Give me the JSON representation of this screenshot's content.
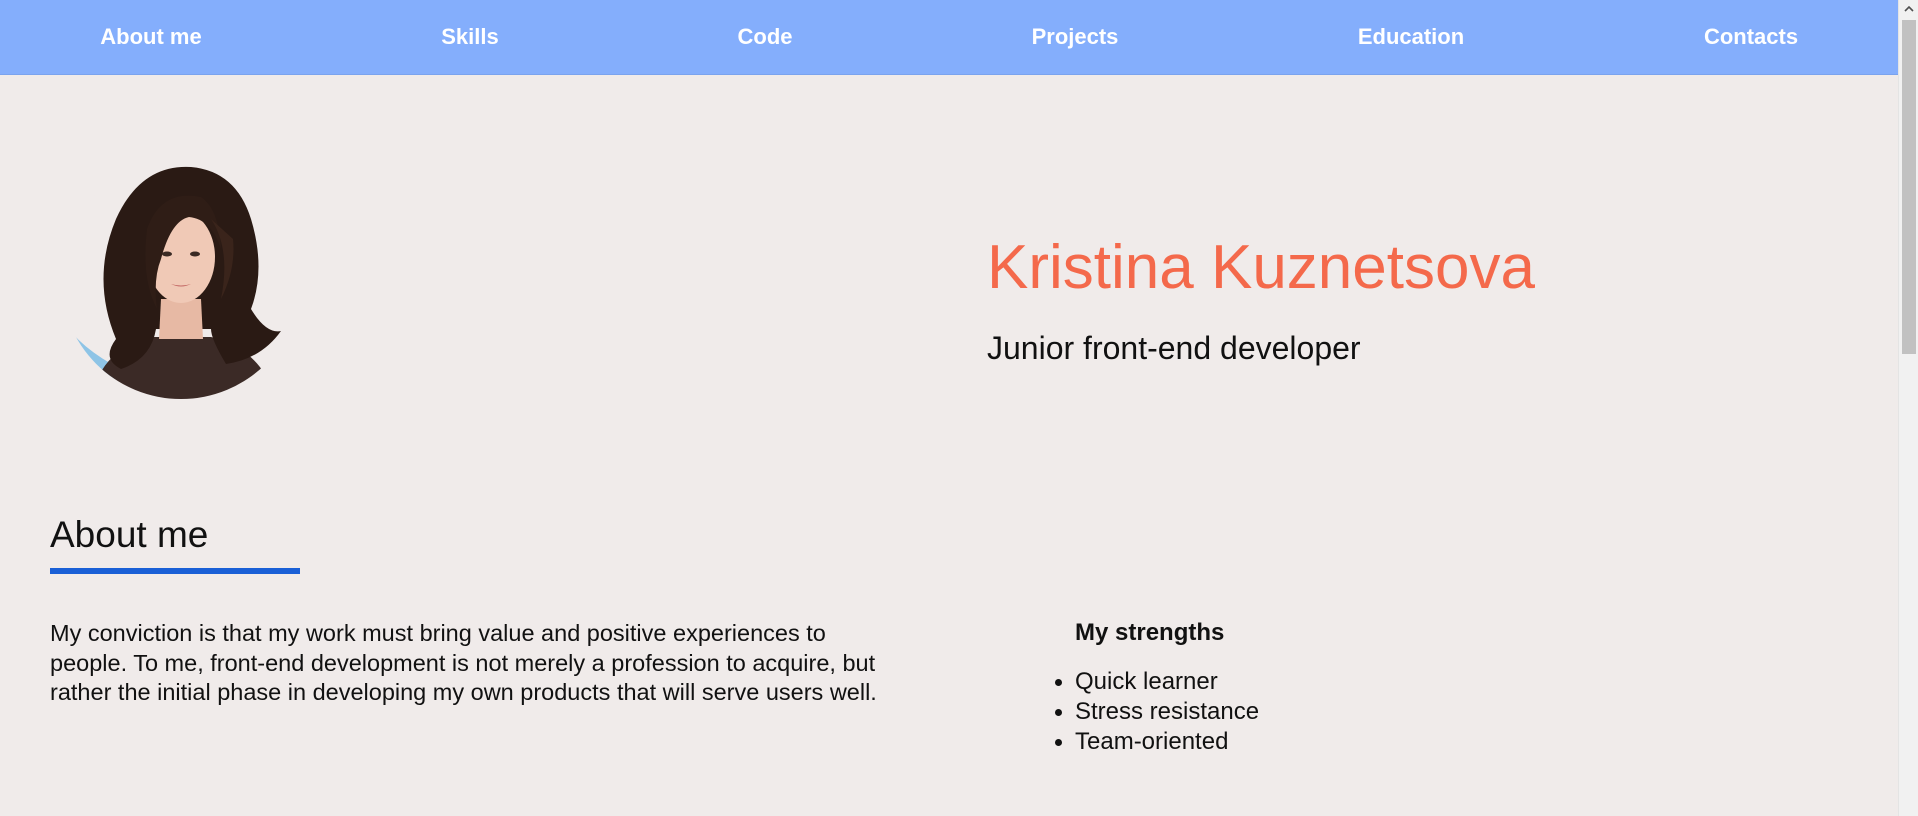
{
  "nav": {
    "items": [
      {
        "label": "About me"
      },
      {
        "label": "Skills"
      },
      {
        "label": "Code"
      },
      {
        "label": "Projects"
      },
      {
        "label": "Education"
      },
      {
        "label": "Contacts"
      }
    ]
  },
  "profile": {
    "name": "Kristina Kuznetsova",
    "role": "Junior front-end developer"
  },
  "about": {
    "title": "About me",
    "text_lines": [
      "My conviction is that my work must bring value and positive experiences to",
      "people. To me, front-end development is not merely a profession to acquire, but",
      "rather the initial phase in developing my own products that will serve users well."
    ],
    "strengths_title": "My strengths",
    "strengths": [
      "Quick learner",
      "Stress resistance",
      "Team-oriented"
    ]
  },
  "colors": {
    "nav_background": "#84aefc",
    "page_background": "#f0ebea",
    "name_accent": "#f4694b",
    "underline": "#1a5fd6"
  }
}
